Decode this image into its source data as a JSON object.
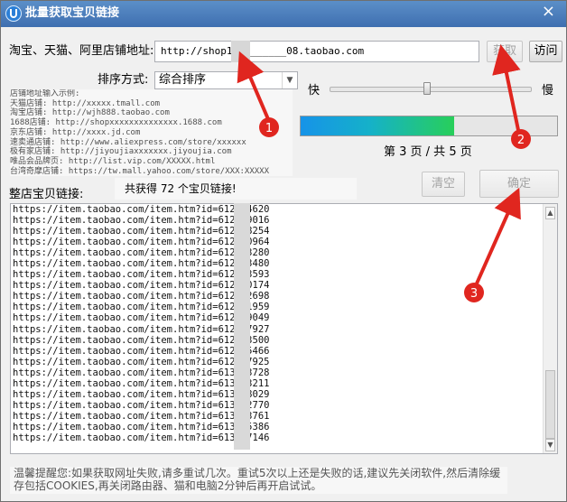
{
  "window": {
    "title": "批量获取宝贝链接",
    "close": "×"
  },
  "form": {
    "store_url_label": "淘宝、天猫、阿里店铺地址:",
    "store_url_value": "http://shop147_______08.taobao.com",
    "fetch_button": "获取",
    "visit_button": "访问",
    "sort_label": "排序方式:",
    "sort_value": "综合排序",
    "speed_fast": "快",
    "speed_slow": "慢",
    "speed_level": 0.48
  },
  "progress": {
    "value": 0.6,
    "text": "第 3 页 / 共 5 页"
  },
  "examples": [
    "店铺地址输入示例:",
    "天猫店铺: http://xxxxx.tmall.com",
    "淘宝店铺: http://wjh888.taobao.com",
    "1688店铺: http://shopxxxxxxxxxxxxxx.1688.com",
    "京东店铺: http://xxxx.jd.com",
    "速卖通店铺: http://www.aliexpress.com/store/xxxxxx",
    "极有家店铺: http://jiyoujiaxxxxxxx.jiyoujia.com",
    "唯品会品牌页: http://list.vip.com/XXXXX.html",
    "台湾奇摩店铺: https://tw.mall.yahoo.com/store/XXX:XXXXX"
  ],
  "results": {
    "label": "整店宝贝链接:",
    "count_text": "共获得 72 个宝贝链接!",
    "clear_button": "清空",
    "confirm_button": "确定",
    "links": [
      "https://item.taobao.com/item.htm?id=6120      4620",
      "https://item.taobao.com/item.htm?id=6121      9016",
      "https://item.taobao.com/item.htm?id=6123      8254",
      "https://item.taobao.com/item.htm?id=6125      0964",
      "https://item.taobao.com/item.htm?id=6126      3280",
      "https://item.taobao.com/item.htm?id=6127      3480",
      "https://item.taobao.com/item.htm?id=6127      3593",
      "https://item.taobao.com/item.htm?id=6127      0174",
      "https://item.taobao.com/item.htm?id=6127      2698",
      "https://item.taobao.com/item.htm?id=6127      1959",
      "https://item.taobao.com/item.htm?id=6127      9049",
      "https://item.taobao.com/item.htm?id=6128      7927",
      "https://item.taobao.com/item.htm?id=6129      3500",
      "https://item.taobao.com/item.htm?id=6129      5466",
      "https://item.taobao.com/item.htm?id=6129      7925",
      "https://item.taobao.com/item.htm?id=6130      3728",
      "https://item.taobao.com/item.htm?id=6130      3211",
      "https://item.taobao.com/item.htm?id=6131      8029",
      "https://item.taobao.com/item.htm?id=6131      2770",
      "https://item.taobao.com/item.htm?id=6132      3761",
      "https://item.taobao.com/item.htm?id=6132      5386",
      "https://item.taobao.com/item.htm?id=6134      7146"
    ]
  },
  "annotations": [
    "1",
    "2",
    "3"
  ],
  "tip": "温馨提醒您:如果获取网址失败,请多重试几次。重试5次以上还是失败的话,建议先关闭软件,然后清除缓存包括COOKIES,再关闭路由器、猫和电脑2分钟后再开启试试。",
  "colors": {
    "title_bar": "#4a80be",
    "progress_start": "#1693e8",
    "progress_end": "#28cf5a",
    "annotation_red": "#e0261f"
  }
}
